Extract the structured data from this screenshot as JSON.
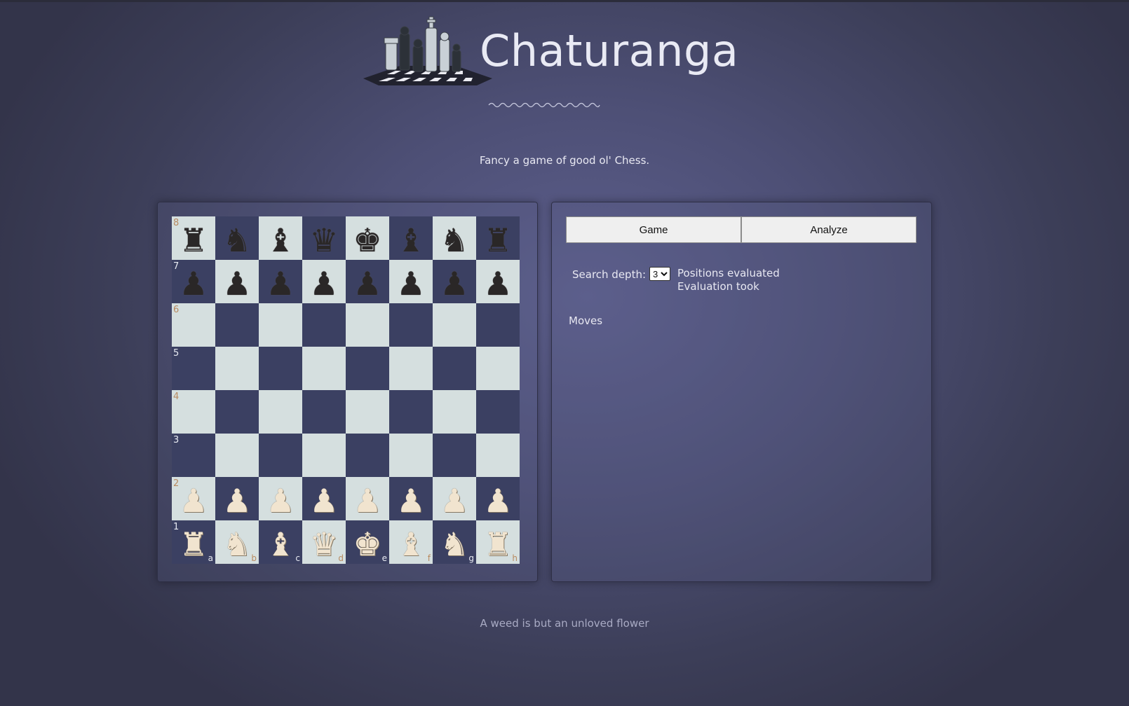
{
  "header": {
    "title": "Chaturanga",
    "tagline": "Fancy a game of good ol' Chess.",
    "logo_icon": "chess-pieces-logo",
    "divider_icon": "wavy-divider"
  },
  "board": {
    "ranks": [
      "8",
      "7",
      "6",
      "5",
      "4",
      "3",
      "2",
      "1"
    ],
    "files": [
      "a",
      "b",
      "c",
      "d",
      "e",
      "f",
      "g",
      "h"
    ],
    "position": [
      [
        "br",
        "bn",
        "bb",
        "bq",
        "bk",
        "bb",
        "bn",
        "br"
      ],
      [
        "bp",
        "bp",
        "bp",
        "bp",
        "bp",
        "bp",
        "bp",
        "bp"
      ],
      [
        "",
        "",
        "",
        "",
        "",
        "",
        "",
        ""
      ],
      [
        "",
        "",
        "",
        "",
        "",
        "",
        "",
        ""
      ],
      [
        "",
        "",
        "",
        "",
        "",
        "",
        "",
        ""
      ],
      [
        "",
        "",
        "",
        "",
        "",
        "",
        "",
        ""
      ],
      [
        "wp",
        "wp",
        "wp",
        "wp",
        "wp",
        "wp",
        "wp",
        "wp"
      ],
      [
        "wr",
        "wn",
        "wb",
        "wq",
        "wk",
        "wb",
        "wn",
        "wr"
      ]
    ],
    "colors": {
      "light": "#d5dfdf",
      "dark": "#3b4062"
    }
  },
  "tabs": {
    "game": "Game",
    "analyze": "Analyze"
  },
  "analysis": {
    "depth_label": "Search depth:",
    "depth_value": "3",
    "positions_label": "Positions evaluated",
    "time_label": "Evaluation took",
    "moves_label": "Moves"
  },
  "footer": {
    "quote": "A weed is but an unloved flower"
  }
}
